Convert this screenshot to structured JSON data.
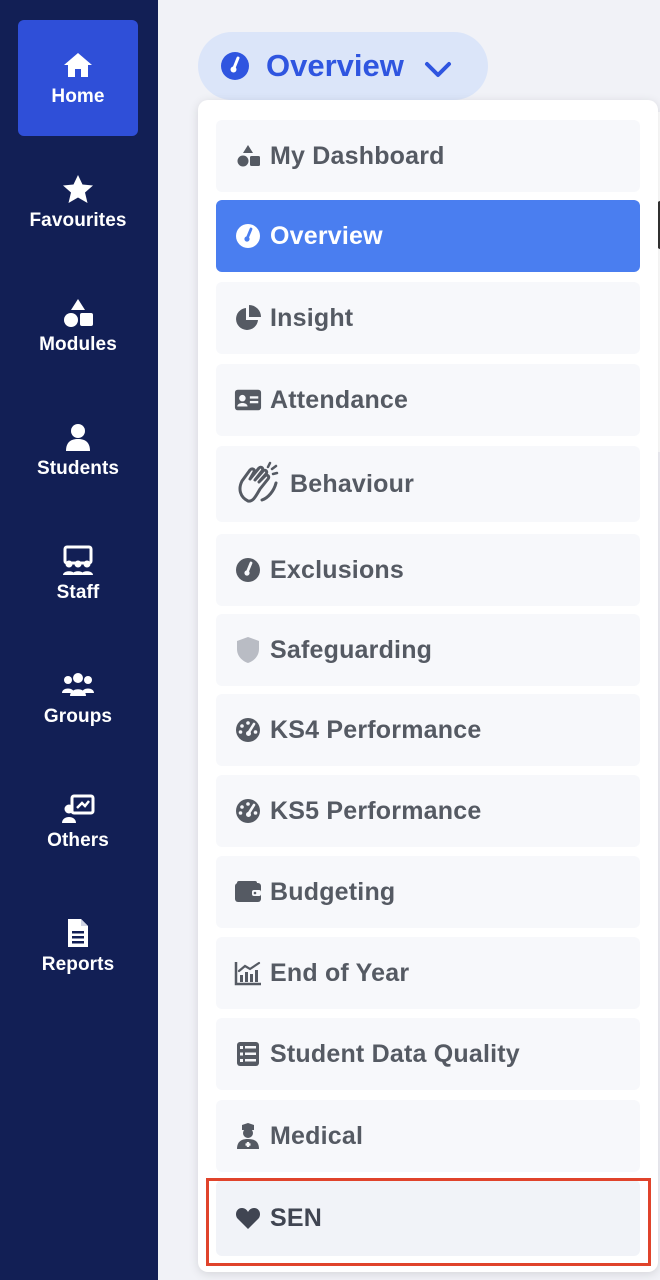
{
  "sidebar": {
    "items": [
      {
        "label": "Home",
        "icon": "home-icon",
        "active": true
      },
      {
        "label": "Favourites",
        "icon": "star-icon",
        "active": false
      },
      {
        "label": "Modules",
        "icon": "shapes-icon",
        "active": false
      },
      {
        "label": "Students",
        "icon": "user-icon",
        "active": false
      },
      {
        "label": "Staff",
        "icon": "chalkboard-users-icon",
        "active": false
      },
      {
        "label": "Groups",
        "icon": "users-icon",
        "active": false
      },
      {
        "label": "Others",
        "icon": "presentation-user-icon",
        "active": false
      },
      {
        "label": "Reports",
        "icon": "file-lines-icon",
        "active": false
      }
    ]
  },
  "dropdown": {
    "current": "Overview",
    "items": [
      {
        "label": "My Dashboard",
        "icon": "shapes-icon"
      },
      {
        "label": "Overview",
        "icon": "gauge-icon",
        "selected": true
      },
      {
        "label": "Insight",
        "icon": "chart-pie-icon"
      },
      {
        "label": "Attendance",
        "icon": "id-card-icon"
      },
      {
        "label": "Behaviour",
        "icon": "hands-clapping-icon"
      },
      {
        "label": "Exclusions",
        "icon": "gauge-icon"
      },
      {
        "label": "Safeguarding",
        "icon": "shield-icon"
      },
      {
        "label": "KS4 Performance",
        "icon": "gauge-high-icon"
      },
      {
        "label": "KS5 Performance",
        "icon": "gauge-high-icon"
      },
      {
        "label": "Budgeting",
        "icon": "wallet-icon"
      },
      {
        "label": "End of Year",
        "icon": "chart-line-icon"
      },
      {
        "label": "Student Data Quality",
        "icon": "list-check-icon"
      },
      {
        "label": "Medical",
        "icon": "user-nurse-icon"
      },
      {
        "label": "SEN",
        "icon": "heart-icon",
        "highlighted": true
      }
    ]
  },
  "colors": {
    "sidebar_bg": "#121f55",
    "sidebar_active": "#2f4fd8",
    "accent": "#2f55e0",
    "selected_item": "#4a7ef0",
    "highlight_border": "#e0432b"
  }
}
